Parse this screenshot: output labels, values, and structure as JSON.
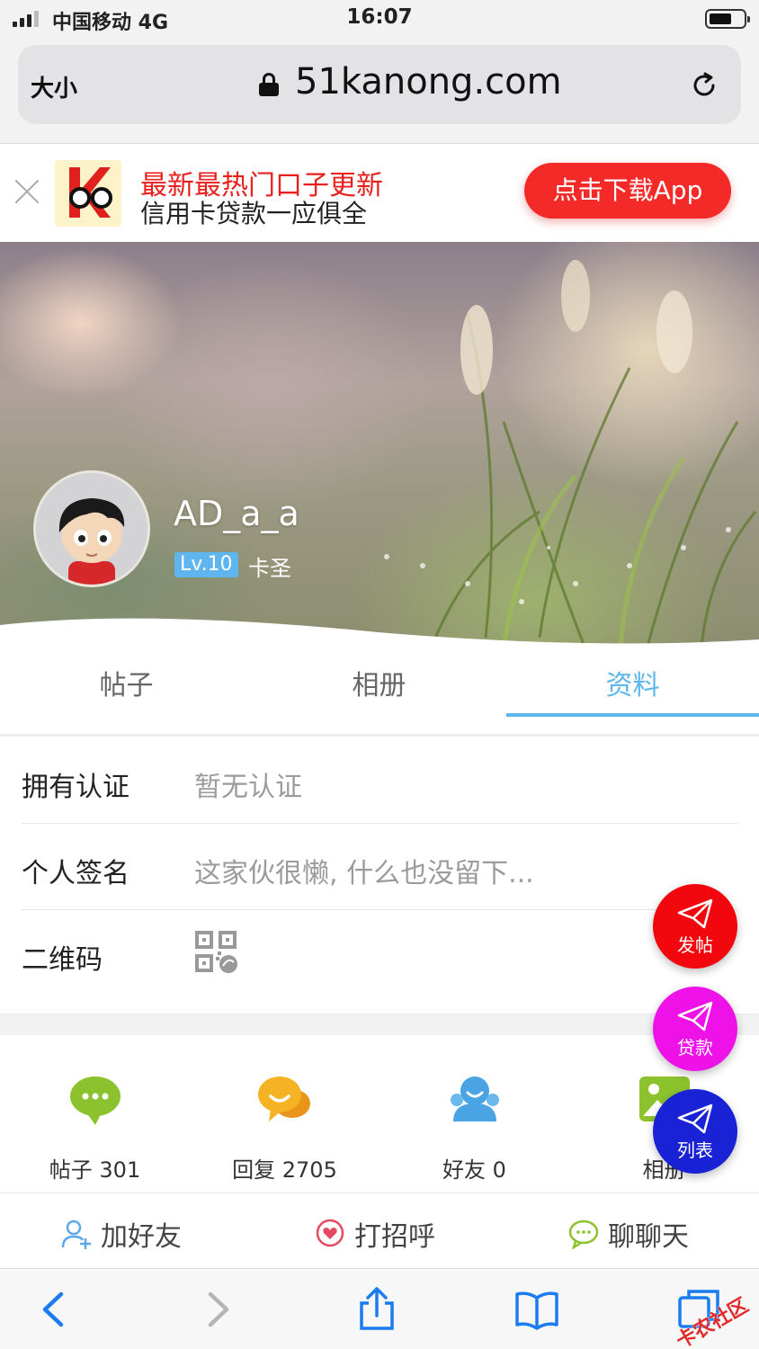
{
  "status_bar": {
    "carrier": "中国移动  4G",
    "time": "16:07"
  },
  "browser": {
    "text_size_label": "大小",
    "url": "51kanong.com"
  },
  "promo": {
    "title": "最新最热门口子更新",
    "subtitle": "信用卡贷款一应俱全",
    "button": "点击下载App"
  },
  "profile": {
    "username": "AD_a_a",
    "level": "Lv.10",
    "rank": "卡圣"
  },
  "tabs": [
    {
      "label": "帖子",
      "active": false
    },
    {
      "label": "相册",
      "active": false
    },
    {
      "label": "资料",
      "active": true
    }
  ],
  "info": {
    "certification": {
      "label": "拥有认证",
      "value": "暂无认证"
    },
    "signature": {
      "label": "个人签名",
      "value": "这家伙很懒, 什么也没留下..."
    },
    "qrcode": {
      "label": "二维码"
    }
  },
  "stats": [
    {
      "label": "帖子 301",
      "icon": "chat-bubble-icon",
      "color": "#8cc22e"
    },
    {
      "label": "回复 2705",
      "icon": "reply-bubbles-icon",
      "color": "#f5a623"
    },
    {
      "label": "好友 0",
      "icon": "friends-icon",
      "color": "#4aa3e3"
    },
    {
      "label": "相册",
      "icon": "album-icon",
      "color": "#8cc22e"
    }
  ],
  "actions": {
    "add_friend": "加好友",
    "greet": "打招呼",
    "chat": "聊聊天"
  },
  "fabs": {
    "post": "发帖",
    "loan": "贷款",
    "list": "列表"
  },
  "fab_colors": {
    "post": "#f2070e",
    "loan": "#ee12e9",
    "list": "#1a22d6"
  },
  "accent": "#5ab7ea",
  "watermark": "卡农社区"
}
